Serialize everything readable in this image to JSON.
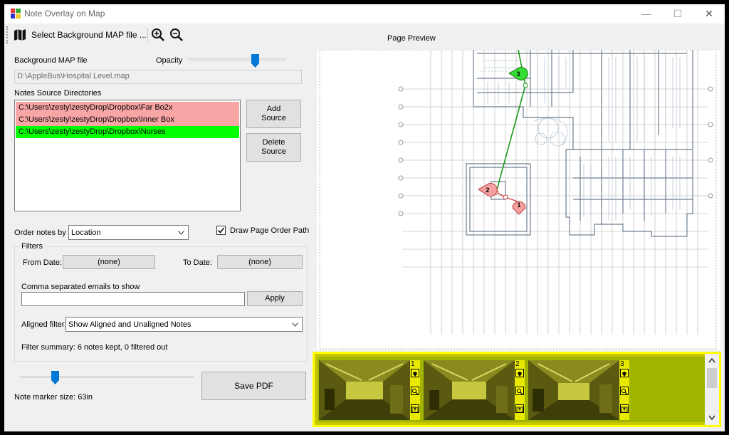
{
  "window": {
    "title": "Note Overlay on Map",
    "minimize": "—",
    "maximize": "☐",
    "close": "✕"
  },
  "toolbar": {
    "select_map_label": "Select Background MAP file ...",
    "icons": [
      "map-icon",
      "zoom-in-icon",
      "zoom-out-icon"
    ]
  },
  "left": {
    "bg_map_label": "Background MAP file",
    "opacity_label": "Opacity",
    "opacity_value": 0.68,
    "map_path": "D:\\AppleBus\\Hospital Level.map",
    "notes_sources_label": "Notes Source Directories",
    "sources": [
      {
        "path": "C:\\Users\\zesty\\zestyDrop\\Dropbox\\Far Bo2x",
        "status": "red"
      },
      {
        "path": "C:\\Users\\zesty\\zestyDrop\\Dropbox\\Inner Box",
        "status": "red"
      },
      {
        "path": "C:\\Users\\zesty\\zestyDrop\\Dropbox\\Nurses",
        "status": "green"
      }
    ],
    "add_source_line1": "Add",
    "add_source_line2": "Source",
    "delete_source_line1": "Delete",
    "delete_source_line2": "Source",
    "order_by_label": "Order notes by",
    "order_by_value": "Location",
    "draw_path_label": "Draw Page Order Path",
    "draw_path_checked": true,
    "filters": {
      "title": "Filters",
      "from_label": "From Date:",
      "from_value": "(none)",
      "to_label": "To Date:",
      "to_value": "(none)",
      "emails_label": "Comma separated emails to show",
      "emails_value": "",
      "apply_label": "Apply",
      "aligned_label": "Aligned filter:",
      "aligned_value": "Show Aligned and Unaligned Notes",
      "summary": "Filter summary: 6 notes kept, 0 filtered out"
    },
    "marker_size_value": 0.2,
    "marker_size_label": "Note marker size: 63in",
    "save_pdf_label": "Save PDF"
  },
  "preview": {
    "label": "Page Preview",
    "markers": [
      "1",
      "2",
      "3"
    ],
    "colors": {
      "pin_red": "#f4a0a0",
      "pin_green": "#33dd33",
      "path_green": "#1a9a1a",
      "path_red": "#d04040"
    }
  },
  "thumbnails": [
    {
      "number": "1"
    },
    {
      "number": "2"
    },
    {
      "number": "3"
    }
  ],
  "colors": {
    "strip_border": "#ffff00",
    "strip_bg": "#a0b400",
    "source_red": "#f7a5a5",
    "source_green": "#00ff00"
  }
}
